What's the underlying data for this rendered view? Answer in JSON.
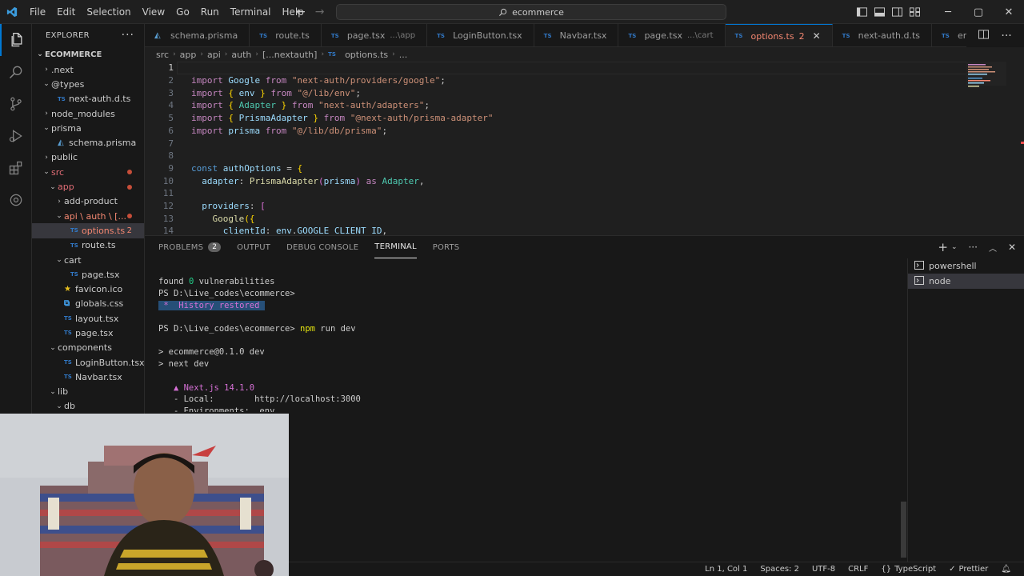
{
  "menu": [
    "File",
    "Edit",
    "Selection",
    "View",
    "Go",
    "Run",
    "Terminal",
    "Help"
  ],
  "search": {
    "label": "ecommerce"
  },
  "explorer": {
    "header": "EXPLORER",
    "root": "ECOMMERCE",
    "items": [
      {
        "label": ".next",
        "type": "folder",
        "depth": 1,
        "open": false
      },
      {
        "label": "@types",
        "type": "folder",
        "depth": 1,
        "open": true
      },
      {
        "label": "next-auth.d.ts",
        "type": "ts",
        "depth": 2
      },
      {
        "label": "node_modules",
        "type": "folder",
        "depth": 1,
        "open": false
      },
      {
        "label": "prisma",
        "type": "folder",
        "depth": 1,
        "open": true
      },
      {
        "label": "schema.prisma",
        "type": "prisma",
        "depth": 2
      },
      {
        "label": "public",
        "type": "folder",
        "depth": 1,
        "open": false
      },
      {
        "label": "src",
        "type": "folder",
        "depth": 1,
        "open": true,
        "modified": true
      },
      {
        "label": "app",
        "type": "folder",
        "depth": 2,
        "open": true,
        "modified": true
      },
      {
        "label": "add-product",
        "type": "folder",
        "depth": 3,
        "open": false
      },
      {
        "label": "api \\ auth \\ [...",
        "type": "folder",
        "depth": 3,
        "open": true,
        "modified": true,
        "error": true
      },
      {
        "label": "options.ts",
        "type": "ts",
        "depth": 4,
        "error": true,
        "badge": "2",
        "selected": true
      },
      {
        "label": "route.ts",
        "type": "ts",
        "depth": 4
      },
      {
        "label": "cart",
        "type": "folder",
        "depth": 3,
        "open": true
      },
      {
        "label": "page.tsx",
        "type": "ts",
        "depth": 4
      },
      {
        "label": "favicon.ico",
        "type": "star",
        "depth": 3
      },
      {
        "label": "globals.css",
        "type": "css",
        "depth": 3
      },
      {
        "label": "layout.tsx",
        "type": "ts",
        "depth": 3
      },
      {
        "label": "page.tsx",
        "type": "ts",
        "depth": 3
      },
      {
        "label": "components",
        "type": "folder",
        "depth": 2,
        "open": true
      },
      {
        "label": "LoginButton.tsx",
        "type": "ts",
        "depth": 3
      },
      {
        "label": "Navbar.tsx",
        "type": "ts",
        "depth": 3
      },
      {
        "label": "lib",
        "type": "folder",
        "depth": 2,
        "open": true
      },
      {
        "label": "db",
        "type": "folder",
        "depth": 3,
        "open": true
      }
    ]
  },
  "tabs": [
    {
      "label": "schema.prisma",
      "icon": "prisma",
      "desc": ""
    },
    {
      "label": "route.ts",
      "icon": "TS",
      "desc": ""
    },
    {
      "label": "page.tsx",
      "icon": "TS",
      "desc": "...\\app"
    },
    {
      "label": "LoginButton.tsx",
      "icon": "TS",
      "desc": ""
    },
    {
      "label": "Navbar.tsx",
      "icon": "TS",
      "desc": ""
    },
    {
      "label": "page.tsx",
      "icon": "TS",
      "desc": "...\\cart"
    },
    {
      "label": "options.ts",
      "icon": "TS",
      "desc": "",
      "active": true,
      "badge": "2"
    },
    {
      "label": "next-auth.d.ts",
      "icon": "TS",
      "desc": ""
    },
    {
      "label": "env.ts",
      "icon": "TS",
      "desc": ""
    }
  ],
  "breadcrumb": [
    "src",
    "app",
    "api",
    "auth",
    "[...nextauth]",
    "options.ts",
    "..."
  ],
  "code": [
    {
      "n": "1",
      "t": []
    },
    {
      "n": "2",
      "t": [
        [
          "kw",
          "import "
        ],
        [
          "id",
          "Google "
        ],
        [
          "kw",
          "from "
        ],
        [
          "str",
          "\"next-auth/providers/google\""
        ],
        [
          "pun",
          ";"
        ]
      ]
    },
    {
      "n": "3",
      "t": [
        [
          "kw",
          "import "
        ],
        [
          "brk",
          "{ "
        ],
        [
          "id",
          "env "
        ],
        [
          "brk",
          "} "
        ],
        [
          "kw",
          "from "
        ],
        [
          "str",
          "\"@/lib/env\""
        ],
        [
          "pun",
          ";"
        ]
      ]
    },
    {
      "n": "4",
      "t": [
        [
          "kw",
          "import "
        ],
        [
          "brk",
          "{ "
        ],
        [
          "cls",
          "Adapter "
        ],
        [
          "brk",
          "} "
        ],
        [
          "kw",
          "from "
        ],
        [
          "str",
          "\"next-auth/adapters\""
        ],
        [
          "pun",
          ";"
        ]
      ]
    },
    {
      "n": "5",
      "t": [
        [
          "kw",
          "import "
        ],
        [
          "brk",
          "{ "
        ],
        [
          "id",
          "PrismaAdapter "
        ],
        [
          "brk",
          "} "
        ],
        [
          "kw",
          "from "
        ],
        [
          "str",
          "\"@next-auth/prisma-adapter\""
        ]
      ]
    },
    {
      "n": "6",
      "t": [
        [
          "kw",
          "import "
        ],
        [
          "id",
          "prisma "
        ],
        [
          "kw",
          "from "
        ],
        [
          "str",
          "\"@/lib/db/prisma\""
        ],
        [
          "pun",
          ";"
        ]
      ]
    },
    {
      "n": "7",
      "t": []
    },
    {
      "n": "8",
      "t": []
    },
    {
      "n": "9",
      "t": [
        [
          "kw2",
          "const "
        ],
        [
          "id",
          "authOptions "
        ],
        [
          "pun",
          "= "
        ],
        [
          "brk",
          "{"
        ]
      ]
    },
    {
      "n": "10",
      "t": [
        [
          "pun",
          "  "
        ],
        [
          "id",
          "adapter"
        ],
        [
          "pun",
          ": "
        ],
        [
          "fn",
          "PrismaAdapter"
        ],
        [
          "brk2",
          "("
        ],
        [
          "id",
          "prisma"
        ],
        [
          "brk2",
          ") "
        ],
        [
          "kw",
          "as "
        ],
        [
          "cls",
          "Adapter"
        ],
        [
          "pun",
          ","
        ]
      ]
    },
    {
      "n": "11",
      "t": []
    },
    {
      "n": "12",
      "t": [
        [
          "pun",
          "  "
        ],
        [
          "id",
          "providers"
        ],
        [
          "pun",
          ": "
        ],
        [
          "brk2",
          "["
        ]
      ]
    },
    {
      "n": "13",
      "t": [
        [
          "pun",
          "    "
        ],
        [
          "fn",
          "Google"
        ],
        [
          "brk",
          "({"
        ]
      ]
    },
    {
      "n": "14",
      "t": [
        [
          "pun",
          "      "
        ],
        [
          "id",
          "clientId"
        ],
        [
          "pun",
          ": "
        ],
        [
          "id",
          "env"
        ],
        [
          "pun",
          "."
        ],
        [
          "id",
          "GOOGLE_CLIENT_ID"
        ],
        [
          "pun",
          ","
        ]
      ]
    }
  ],
  "panel": {
    "tabs": [
      {
        "label": "PROBLEMS",
        "count": "2"
      },
      {
        "label": "OUTPUT"
      },
      {
        "label": "DEBUG CONSOLE"
      },
      {
        "label": "TERMINAL",
        "active": true
      },
      {
        "label": "PORTS"
      }
    ],
    "terminals": [
      {
        "label": "powershell"
      },
      {
        "label": "node",
        "selected": true
      }
    ]
  },
  "terminal": [
    [
      [
        "",
        "found "
      ],
      [
        "green",
        "0"
      ],
      [
        "",
        " vulnerabilities"
      ]
    ],
    [
      [
        "",
        "PS D:\\Live_codes\\ecommerce>"
      ]
    ],
    [
      [
        "hist",
        " *  History restored "
      ]
    ],
    [],
    [
      [
        "",
        "PS D:\\Live_codes\\ecommerce> "
      ],
      [
        "yellow",
        "npm"
      ],
      [
        "",
        " run dev"
      ]
    ],
    [],
    [
      [
        "",
        "> ecommerce@0.1.0 dev"
      ]
    ],
    [
      [
        "",
        "> next dev"
      ]
    ],
    [],
    [
      [
        "magenta",
        "   ▲ Next.js 14.1.0"
      ]
    ],
    [
      [
        "",
        "   - Local:        http://localhost:3000"
      ]
    ],
    [
      [
        "",
        "   - Environments: .env"
      ]
    ]
  ],
  "status": {
    "position": "Ln 1, Col 1",
    "spaces": "Spaces: 2",
    "encoding": "UTF-8",
    "eol": "CRLF",
    "language": "TypeScript",
    "formatter": "Prettier"
  },
  "colors": {
    "accent": "#0078d4",
    "error": "#f48771",
    "background": "#1f1f1f"
  }
}
